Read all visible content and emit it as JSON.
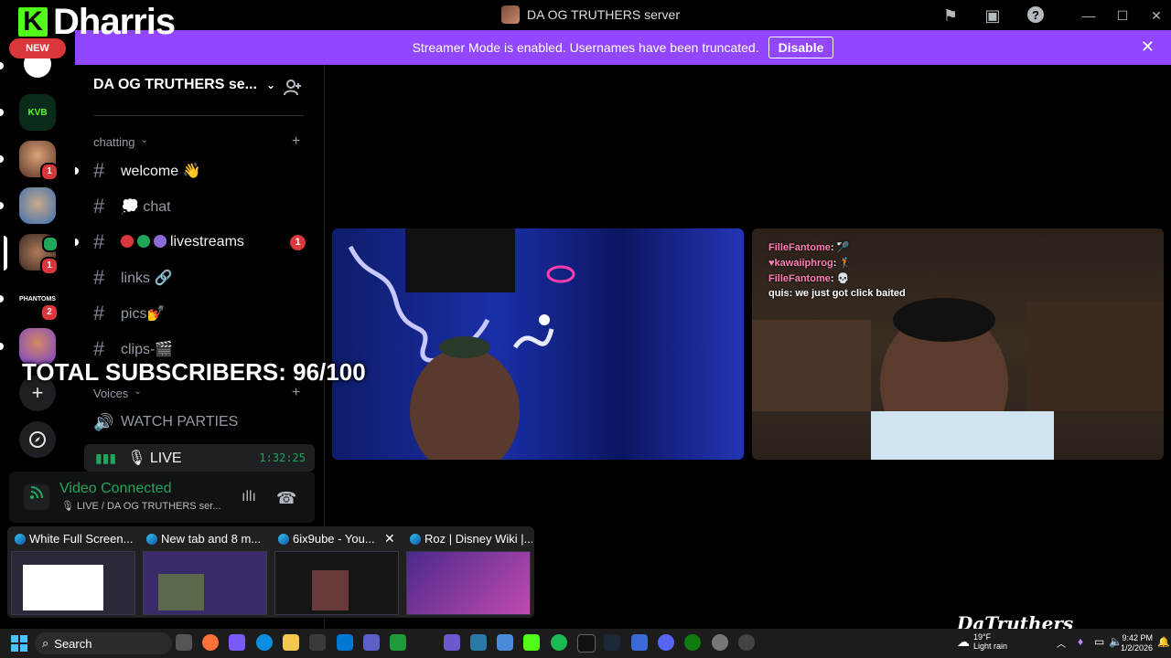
{
  "brand": {
    "logo_letter": "K",
    "name": "Dharris",
    "accent": "#53fc18"
  },
  "window": {
    "title": "DA OG TRUTHERS server"
  },
  "banner": {
    "text": "Streamer Mode is enabled. Usernames have been truncated.",
    "button": "Disable",
    "color": "#9147ff"
  },
  "rail": {
    "new_badge": "NEW",
    "kvb_label": "KVB",
    "badges": [
      "1",
      "1",
      "2"
    ],
    "phantoms_label": "PHANTOMS"
  },
  "server": {
    "name": "DA OG TRUTHERS se...",
    "categories": {
      "chatting": "chatting",
      "voices": "Voices"
    },
    "channels": {
      "welcome": "welcome 👋",
      "chat": "💭 chat",
      "livestreams": "livestreams",
      "livestreams_badge": "1",
      "links": "links 🔗",
      "pics": "pics💅",
      "clips": "clips-🎬",
      "watch": "WATCH PARTIES",
      "live": "🎙 LIVE",
      "live_time": "1:32:25"
    }
  },
  "overlay": {
    "subscribers": "TOTAL SUBSCRIBERS: 96/100"
  },
  "voice": {
    "status": "Video Connected",
    "channel": "🎙 LIVE / DA OG TRUTHERS ser..."
  },
  "stream_chat": [
    {
      "user": "FilleFantome",
      "msg": "🏸"
    },
    {
      "user": "♥kawaiiphrog",
      "msg": "🏌"
    },
    {
      "user": "FilleFantome",
      "msg": "💀"
    },
    {
      "user": "quis",
      "msg": "we just got click baited"
    }
  ],
  "thumbnails": [
    {
      "title": "White Full Screen..."
    },
    {
      "title": "New tab and 8 m..."
    },
    {
      "title": "6ix9ube - You..."
    },
    {
      "title": "Roz | Disney Wiki |..."
    }
  ],
  "watermark": "DaTruthers",
  "taskbar": {
    "search": "Search",
    "temp": "19°F",
    "weather": "Light rain",
    "time": "9:42 PM",
    "date": "1/2/2026"
  }
}
